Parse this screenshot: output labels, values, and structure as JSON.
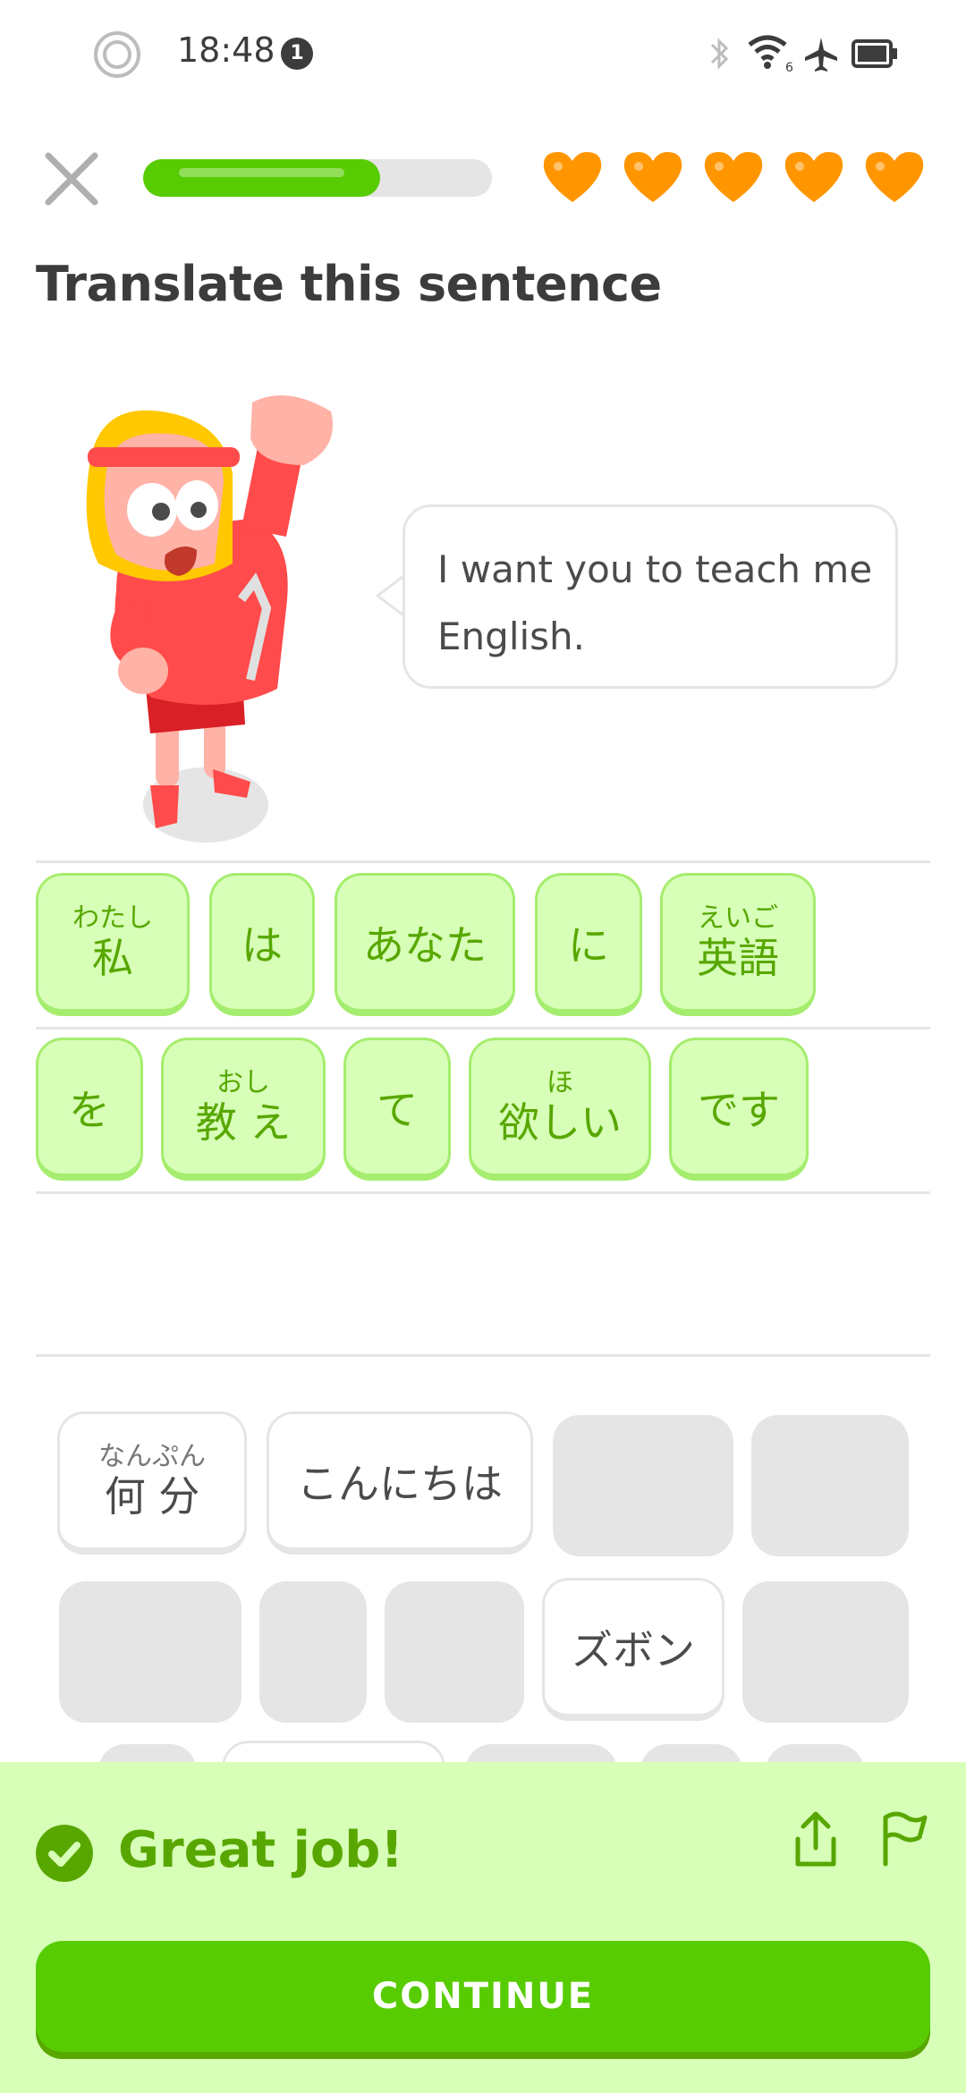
{
  "status_bar": {
    "time": "18:48",
    "notification_count": "1",
    "wifi_label": "6"
  },
  "top_bar": {
    "progress": 0.68,
    "hearts_count": 5,
    "heart_color": "#ff9600"
  },
  "title": "Translate this sentence",
  "speech_bubble": {
    "text": "I want you to teach me English."
  },
  "answer_tiles": [
    {
      "ruby": "わたし",
      "base": "私"
    },
    {
      "ruby": "",
      "base": "は"
    },
    {
      "ruby": "",
      "base": "あなた"
    },
    {
      "ruby": "",
      "base": "に"
    },
    {
      "ruby": "えいご",
      "base": "英語"
    },
    {
      "ruby": "",
      "base": "を"
    },
    {
      "ruby": "おし",
      "base": "教 え"
    },
    {
      "ruby": "",
      "base": "て"
    },
    {
      "ruby": "ほ",
      "base": "欲しい"
    },
    {
      "ruby": "",
      "base": "です"
    }
  ],
  "word_bank": [
    {
      "ruby": "なんぷん",
      "base": "何 分"
    },
    {
      "ruby": "",
      "base": "こんにちは"
    },
    {
      "ruby": "",
      "base": "ズボン"
    }
  ],
  "feedback": {
    "message": "Great job!",
    "continue_label": "CONTINUE"
  },
  "colors": {
    "accent_green": "#58cc02",
    "dark_green": "#58a700",
    "light_green": "#d7ffb8"
  }
}
